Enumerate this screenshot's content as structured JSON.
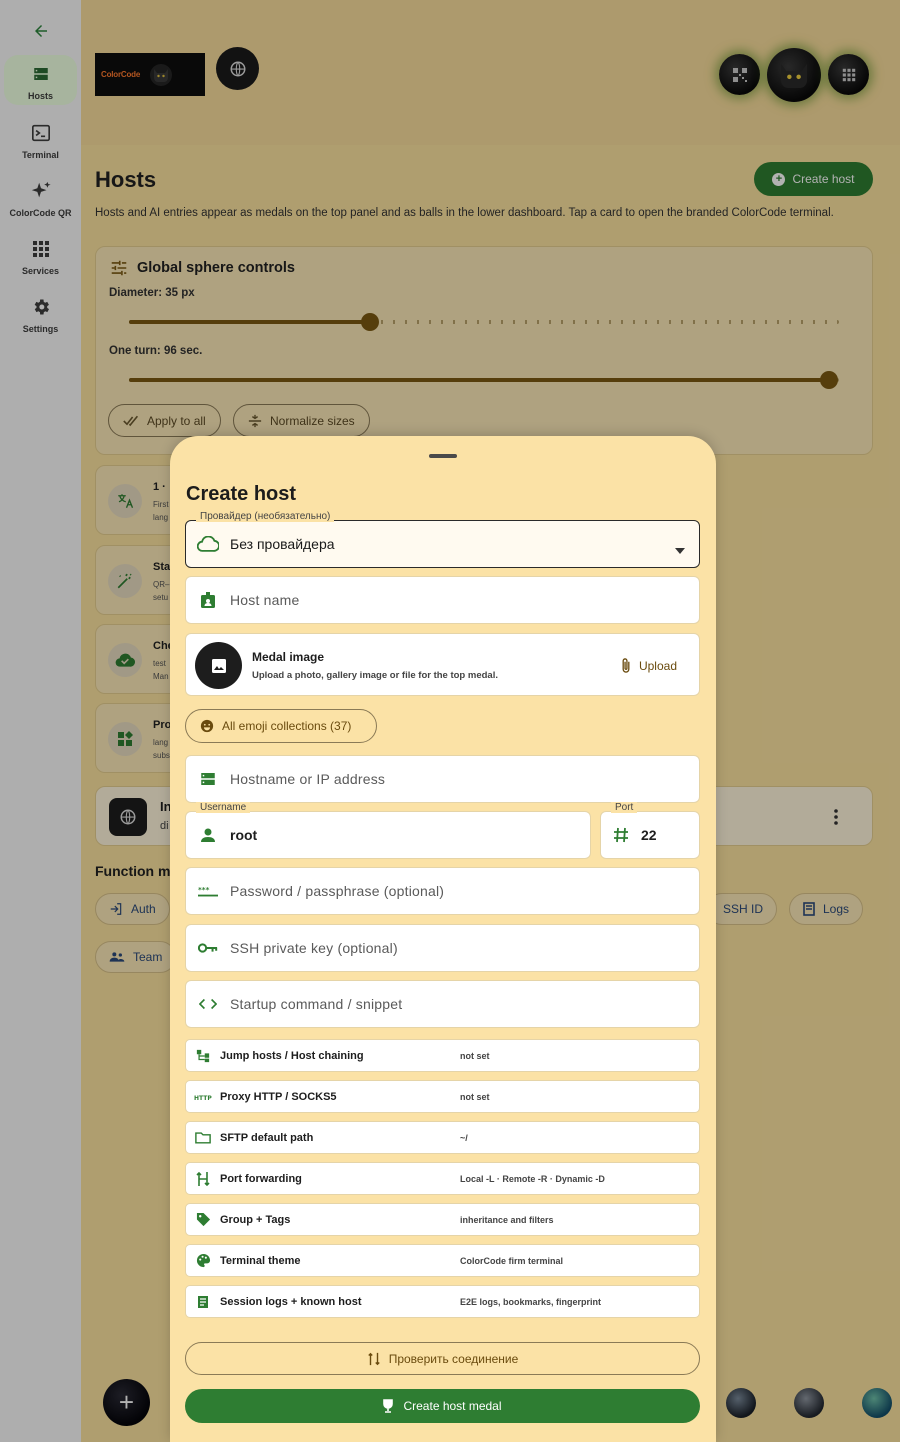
{
  "rail": {
    "items": [
      {
        "label": "Hosts",
        "icon": "hosts-icon"
      },
      {
        "label": "Terminal",
        "icon": "terminal-icon"
      },
      {
        "label": "ColorCode QR",
        "icon": "sparkle-icon"
      },
      {
        "label": "Services",
        "icon": "grid-icon"
      },
      {
        "label": "Settings",
        "icon": "gear-icon"
      }
    ]
  },
  "topbar": {
    "logo_text": "ColorCode"
  },
  "page": {
    "title": "Hosts",
    "create_host_label": "Create host",
    "description": "Hosts and AI entries appear as medals on the top panel and as balls in the lower dashboard. Tap a card to open the branded ColorCode terminal."
  },
  "sphere": {
    "title": "Global sphere controls",
    "diameter_label": "Diameter: 35 px",
    "diameter_fraction": 0.34,
    "turn_label": "One turn: 96 sec.",
    "turn_fraction": 1.0,
    "apply_label": "Apply to all",
    "normalize_label": "Normalize sizes"
  },
  "list": [
    {
      "title": "1 ·",
      "sub1": "First",
      "sub2": "lang"
    },
    {
      "title": "Sta",
      "sub1": "QR–",
      "sub2": "setu"
    },
    {
      "title": "Che",
      "sub1": "test",
      "sub2": "Man"
    },
    {
      "title": "Pro",
      "sub1": "lang",
      "sub2": "subs"
    }
  ],
  "internet_card": {
    "title": "In",
    "sub": "di"
  },
  "functions": {
    "title": "Function m",
    "chips": {
      "auth": "Auth",
      "team": "Team",
      "ssh_id": "SSH ID",
      "logs": "Logs"
    }
  },
  "sheet": {
    "title": "Create host",
    "provider_label": "Провайдер (необязательно)",
    "provider_value": "Без провайдера",
    "host_name_placeholder": "Host name",
    "medal_title": "Medal image",
    "medal_sub": "Upload a photo, gallery image or file for the top medal.",
    "upload_label": "Upload",
    "emoji_label": "All emoji collections (37)",
    "hostname_placeholder": "Hostname or IP address",
    "username_label": "Username",
    "username_value": "root",
    "port_label": "Port",
    "port_value": "22",
    "password_placeholder": "Password / passphrase (optional)",
    "ssh_key_placeholder": "SSH private key (optional)",
    "startup_placeholder": "Startup command / snippet",
    "options": [
      {
        "label": "Jump hosts / Host chaining",
        "value": "not set",
        "icon": "jump-hosts-icon"
      },
      {
        "label": "Proxy HTTP / SOCKS5",
        "value": "not set",
        "icon": "http-icon"
      },
      {
        "label": "SFTP default path",
        "value": "~/",
        "icon": "folder-icon"
      },
      {
        "label": "Port forwarding",
        "value": "Local -L · Remote -R · Dynamic -D",
        "icon": "port-forward-icon"
      },
      {
        "label": "Group + Tags",
        "value": "inheritance and filters",
        "icon": "tag-icon"
      },
      {
        "label": "Terminal theme",
        "value": "ColorCode firm terminal",
        "icon": "palette-icon"
      },
      {
        "label": "Session logs + known host",
        "value": "E2E logs, bookmarks, fingerprint",
        "icon": "log-icon"
      }
    ],
    "check_label": "Проверить соединение",
    "create_label": "Create host medal"
  },
  "colors": {
    "accent_green": "#2e7d32",
    "sheet_bg": "#fbe2a6",
    "slider_brown": "#7b5a12"
  }
}
